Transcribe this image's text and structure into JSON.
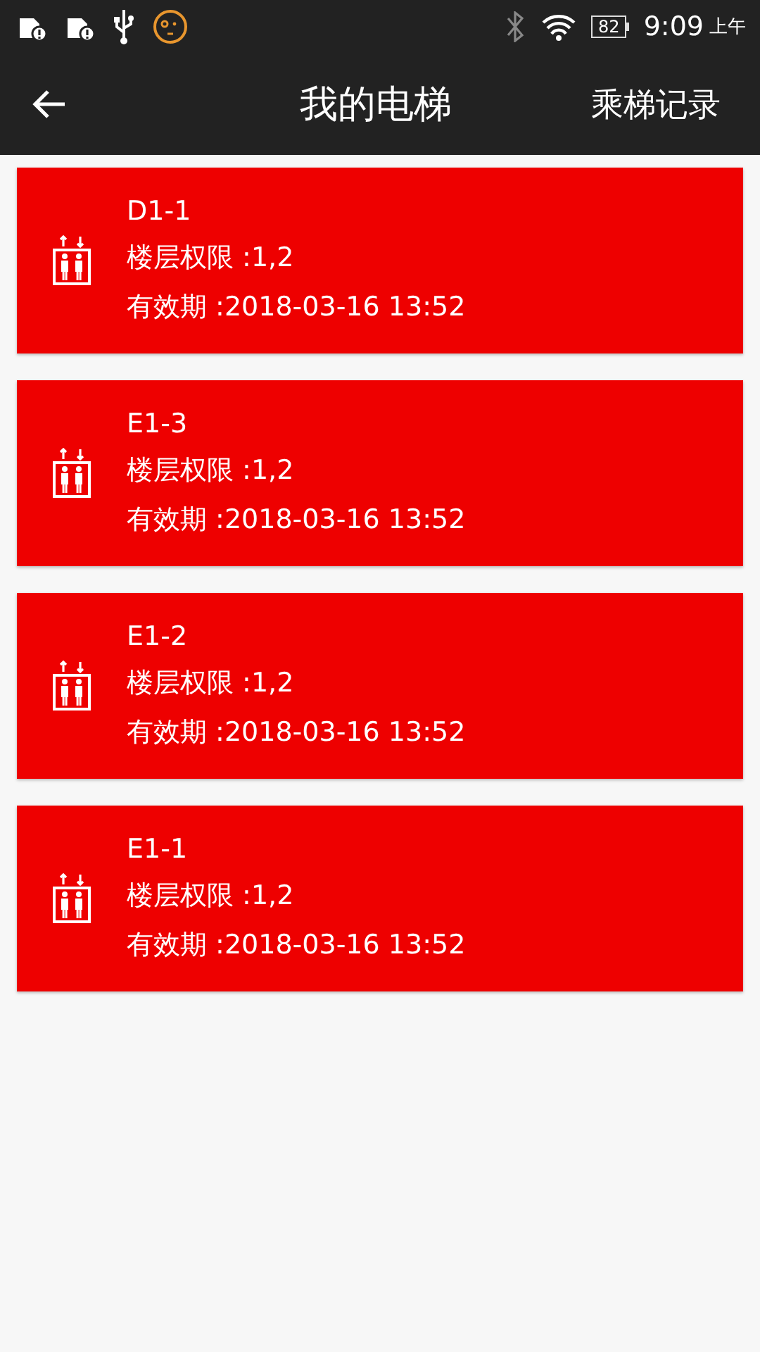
{
  "status_bar": {
    "battery": "82",
    "time": "9:09",
    "period": "上午"
  },
  "toolbar": {
    "title": "我的电梯",
    "action": "乘梯记录"
  },
  "elevators": [
    {
      "name": "D1-1",
      "floors": "楼层权限 :1,2",
      "validity": "有效期 :2018-03-16 13:52"
    },
    {
      "name": "E1-3",
      "floors": "楼层权限 :1,2",
      "validity": "有效期 :2018-03-16 13:52"
    },
    {
      "name": "E1-2",
      "floors": "楼层权限 :1,2",
      "validity": "有效期 :2018-03-16 13:52"
    },
    {
      "name": "E1-1",
      "floors": "楼层权限 :1,2",
      "validity": "有效期 :2018-03-16 13:52"
    }
  ]
}
